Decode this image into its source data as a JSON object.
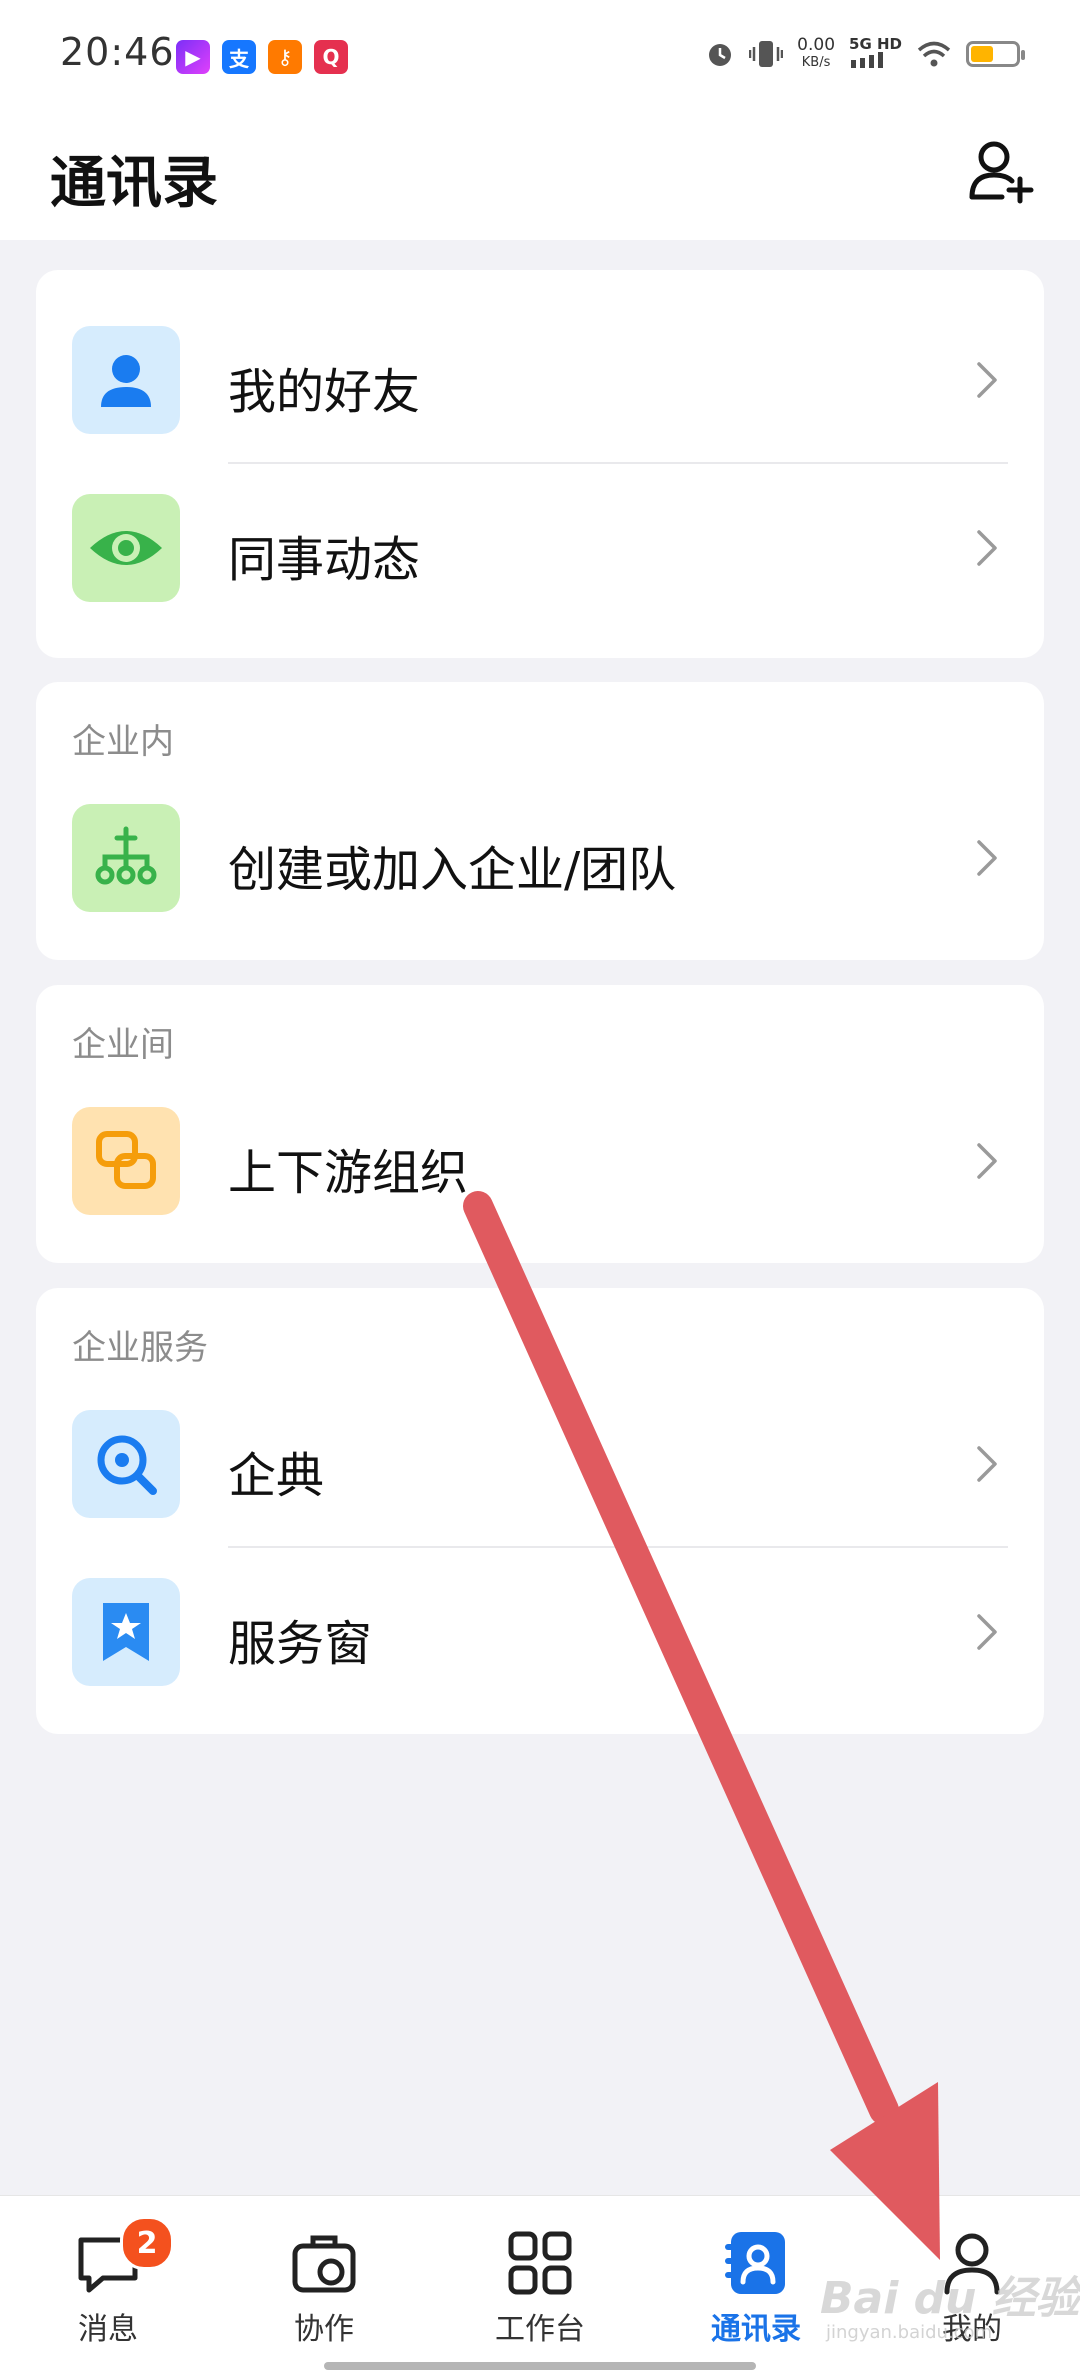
{
  "status_bar": {
    "time": "20:46",
    "speed_value": "0.00",
    "speed_unit": "KB/s",
    "network": "5G HD",
    "battery_color": "#ffb400",
    "battery_level_pct": 55
  },
  "header": {
    "title": "通讯录",
    "add_icon": "add-contact-icon"
  },
  "cards": {
    "friends": {
      "items": [
        {
          "label": "我的好友",
          "icon": "person-icon"
        },
        {
          "label": "同事动态",
          "icon": "eye-icon"
        }
      ]
    },
    "internal": {
      "section_title": "企业内",
      "items": [
        {
          "label": "创建或加入企业/团队",
          "icon": "org-tree-icon"
        }
      ]
    },
    "inter": {
      "section_title": "企业间",
      "items": [
        {
          "label": "上下游组织",
          "icon": "link-icon"
        }
      ]
    },
    "services": {
      "section_title": "企业服务",
      "items": [
        {
          "label": "企典",
          "icon": "search-icon"
        },
        {
          "label": "服务窗",
          "icon": "bookmark-star-icon"
        }
      ]
    }
  },
  "bottom_nav": {
    "items": [
      {
        "label": "消息",
        "icon": "message-icon",
        "badge": "2"
      },
      {
        "label": "协作",
        "icon": "briefcase-icon"
      },
      {
        "label": "工作台",
        "icon": "grid-icon"
      },
      {
        "label": "通讯录",
        "icon": "contacts-icon",
        "active": true
      },
      {
        "label": "我的",
        "icon": "profile-icon"
      }
    ],
    "active_color": "#1a73e8"
  },
  "watermark": {
    "text": "Bai du 经验",
    "sub": "jingyan.baidu.com"
  },
  "annotation": {
    "arrow_color": "#e05a5f"
  }
}
